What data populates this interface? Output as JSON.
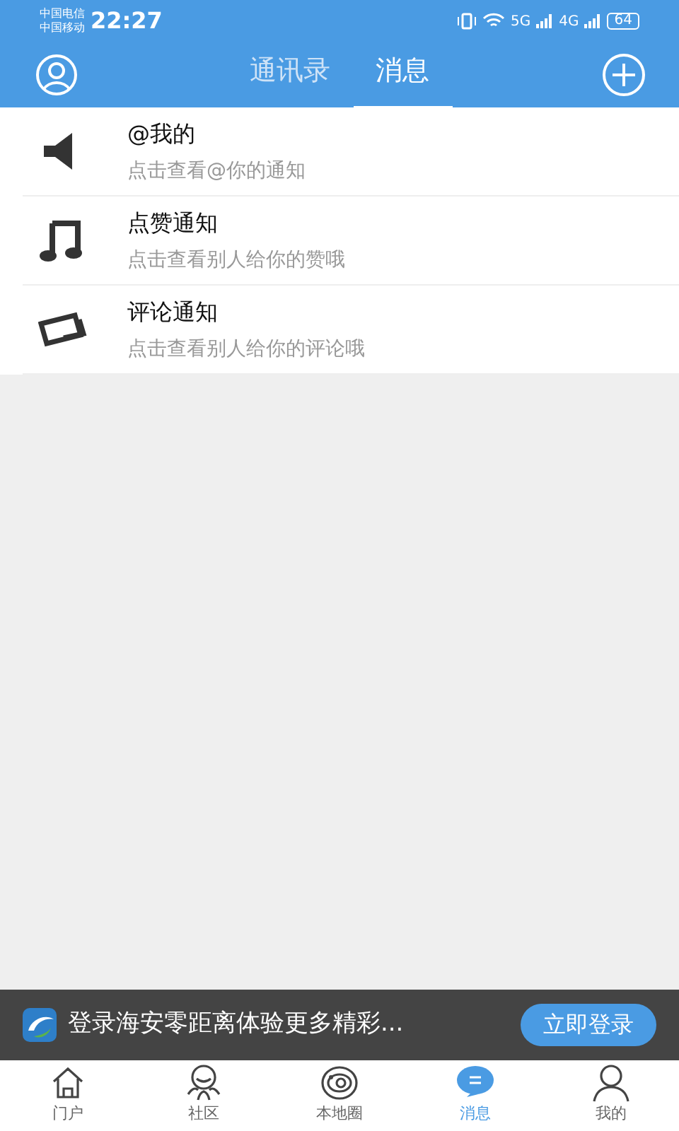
{
  "status_bar": {
    "carriers": [
      "中国电信",
      "中国移动"
    ],
    "time": "22:27",
    "network_labels": [
      "5G",
      "4G"
    ],
    "battery": "64"
  },
  "header": {
    "tabs": [
      {
        "label": "通讯录",
        "selected": false
      },
      {
        "label": "消息",
        "selected": true
      }
    ]
  },
  "messages": [
    {
      "kind": "speaker",
      "title": "@我的",
      "subtitle": "点击查看@你的通知"
    },
    {
      "kind": "music",
      "title": "点赞通知",
      "subtitle": "点击查看别人给你的赞哦"
    },
    {
      "kind": "comment",
      "title": "评论通知",
      "subtitle": "点击查看别人给你的评论哦"
    }
  ],
  "login_banner": {
    "text": "登录海安零距离体验更多精彩...",
    "button": "立即登录"
  },
  "bottom_nav": [
    {
      "kind": "home",
      "label": "门户",
      "selected": false
    },
    {
      "kind": "community",
      "label": "社区",
      "selected": false
    },
    {
      "kind": "local",
      "label": "本地圈",
      "selected": false
    },
    {
      "kind": "message",
      "label": "消息",
      "selected": true
    },
    {
      "kind": "profile",
      "label": "我的",
      "selected": false
    }
  ]
}
